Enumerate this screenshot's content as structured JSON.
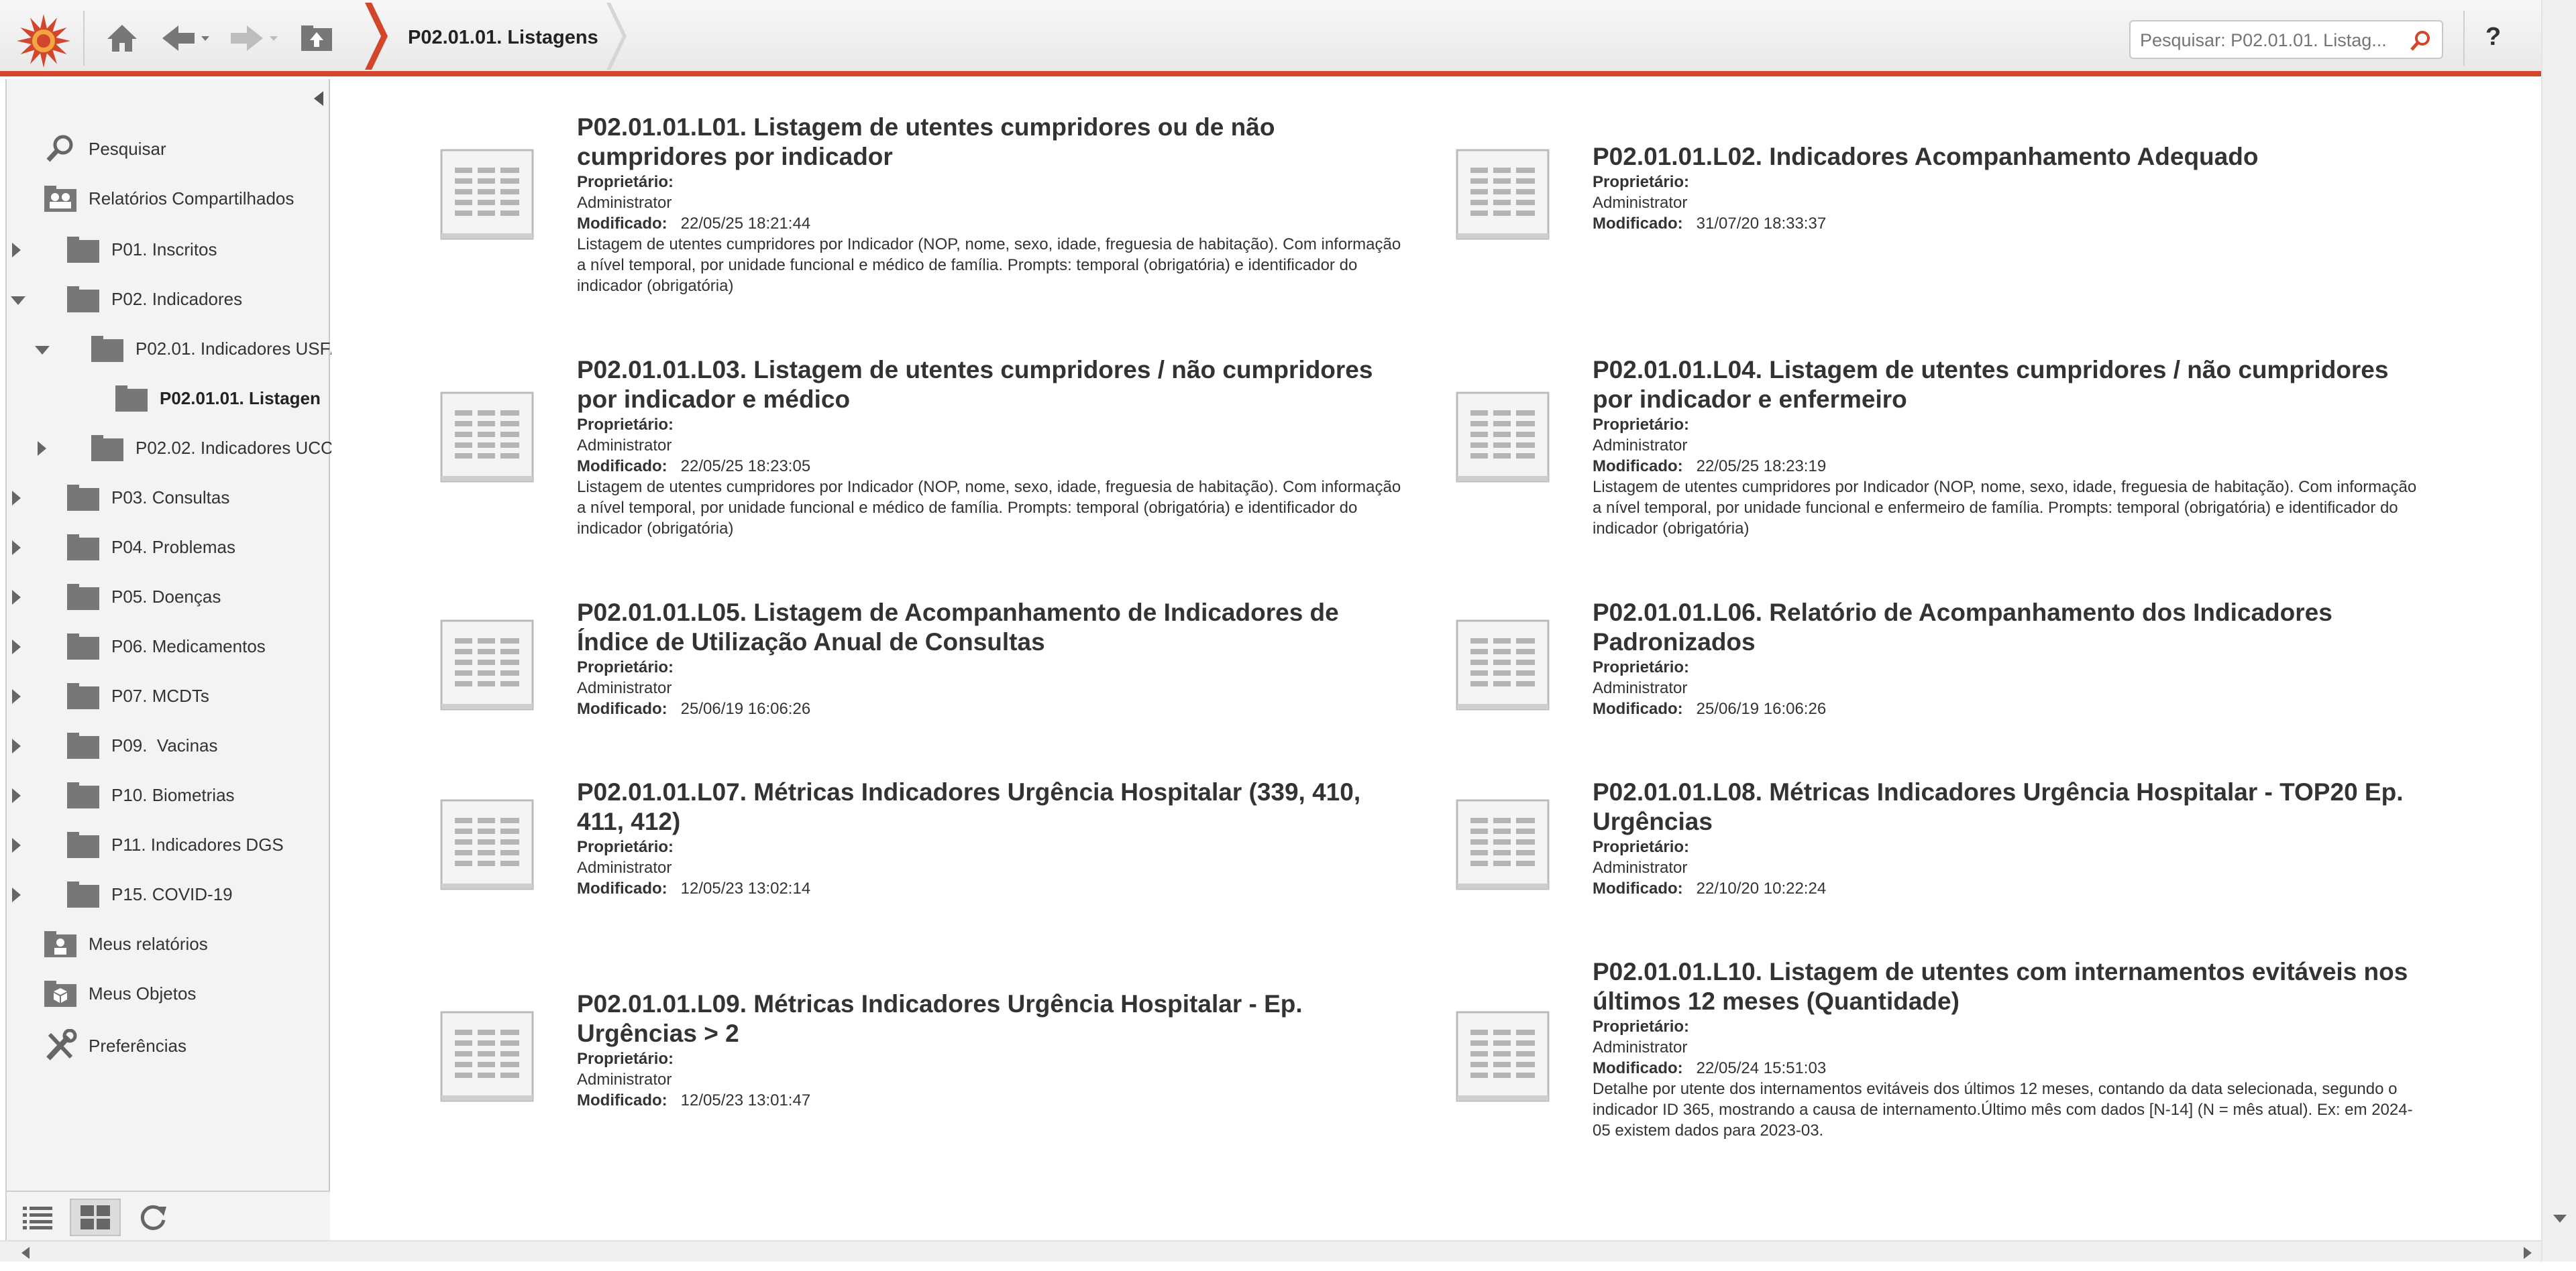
{
  "header": {
    "breadcrumb": "P02.01.01. Listagens",
    "search_placeholder": "Pesquisar: P02.01.01. Listag...",
    "help_label": "?"
  },
  "sidebar": {
    "items": [
      {
        "label": "Pesquisar"
      },
      {
        "label": "Relatórios Compartilhados"
      },
      {
        "label": "P01. Inscritos"
      },
      {
        "label": "P02. Indicadores"
      },
      {
        "label": "P02.01. Indicadores USF/"
      },
      {
        "label": "P02.01.01. Listagen"
      },
      {
        "label": "P02.02. Indicadores UCC"
      },
      {
        "label": "P03. Consultas"
      },
      {
        "label": "P04. Problemas"
      },
      {
        "label": "P05. Doenças"
      },
      {
        "label": "P06. Medicamentos"
      },
      {
        "label": "P07. MCDTs"
      },
      {
        "label": "P09.  Vacinas"
      },
      {
        "label": "P10. Biometrias"
      },
      {
        "label": "P11. Indicadores DGS"
      },
      {
        "label": "P15. COVID-19"
      },
      {
        "label": "Meus relatórios"
      },
      {
        "label": "Meus Objetos"
      },
      {
        "label": "Preferências"
      }
    ]
  },
  "labels": {
    "owner": "Proprietário:",
    "modified": "Modificado:"
  },
  "reports": [
    {
      "title": "P02.01.01.L01. Listagem de utentes cumpridores ou de não cumpridores por indicador",
      "owner": "Administrator",
      "modified": "22/05/25 18:21:44",
      "description": "Listagem de utentes cumpridores por Indicador (NOP, nome, sexo, idade, freguesia de habitação). Com informação a nível temporal, por unidade funcional e médico de família. Prompts: temporal (obrigatória) e identificador do indicador (obrigatória)"
    },
    {
      "title": "P02.01.01.L02. Indicadores Acompanhamento Adequado",
      "owner": "Administrator",
      "modified": "31/07/20 18:33:37",
      "description": ""
    },
    {
      "title": "P02.01.01.L03. Listagem de utentes cumpridores / não cumpridores por indicador e médico",
      "owner": "Administrator",
      "modified": "22/05/25 18:23:05",
      "description": "Listagem de utentes cumpridores por Indicador (NOP, nome, sexo, idade, freguesia de habitação). Com informação a nível temporal, por unidade funcional e médico de família. Prompts: temporal (obrigatória) e identificador do indicador (obrigatória)"
    },
    {
      "title": "P02.01.01.L04. Listagem de utentes cumpridores / não cumpridores por indicador e enfermeiro",
      "owner": "Administrator",
      "modified": "22/05/25 18:23:19",
      "description": "Listagem de utentes cumpridores por Indicador (NOP, nome, sexo, idade, freguesia de habitação). Com informação a nível temporal, por unidade funcional e enfermeiro de família. Prompts: temporal (obrigatória) e identificador do indicador (obrigatória)"
    },
    {
      "title": "P02.01.01.L05. Listagem de Acompanhamento de Indicadores de Índice de Utilização Anual de Consultas",
      "owner": "Administrator",
      "modified": "25/06/19 16:06:26",
      "description": ""
    },
    {
      "title": "P02.01.01.L06. Relatório de Acompanhamento dos Indicadores Padronizados",
      "owner": "Administrator",
      "modified": "25/06/19 16:06:26",
      "description": ""
    },
    {
      "title": "P02.01.01.L07. Métricas Indicadores Urgência Hospitalar (339, 410, 411, 412)",
      "owner": "Administrator",
      "modified": "12/05/23 13:02:14",
      "description": ""
    },
    {
      "title": "P02.01.01.L08. Métricas Indicadores Urgência Hospitalar - TOP20 Ep. Urgências",
      "owner": "Administrator",
      "modified": "22/10/20 10:22:24",
      "description": ""
    },
    {
      "title": "P02.01.01.L09. Métricas Indicadores Urgência Hospitalar - Ep. Urgências > 2",
      "owner": "Administrator",
      "modified": "12/05/23 13:01:47",
      "description": ""
    },
    {
      "title": "P02.01.01.L10. Listagem de utentes com internamentos evitáveis nos últimos 12 meses (Quantidade)",
      "owner": "Administrator",
      "modified": "22/05/24 15:51:03",
      "description": "Detalhe por utente dos internamentos evitáveis dos últimos 12 meses, contando da data selecionada, segundo o indicador ID 365, mostrando a causa de internamento.Último mês com dados [N-14] (N = mês atual). Ex: em 2024-05 existem dados para 2023-03."
    }
  ],
  "colors": {
    "accent": "#d2462c",
    "folder": "#7a7a7a"
  },
  "icons": [
    "app-logo-icon",
    "home-icon",
    "back-icon",
    "forward-icon",
    "up-folder-icon",
    "search-icon",
    "help-icon",
    "folder-icon",
    "shared-reports-icon",
    "my-reports-icon",
    "my-objects-icon",
    "preferences-icon",
    "report-icon",
    "list-view-icon",
    "grid-view-icon",
    "refresh-icon"
  ]
}
